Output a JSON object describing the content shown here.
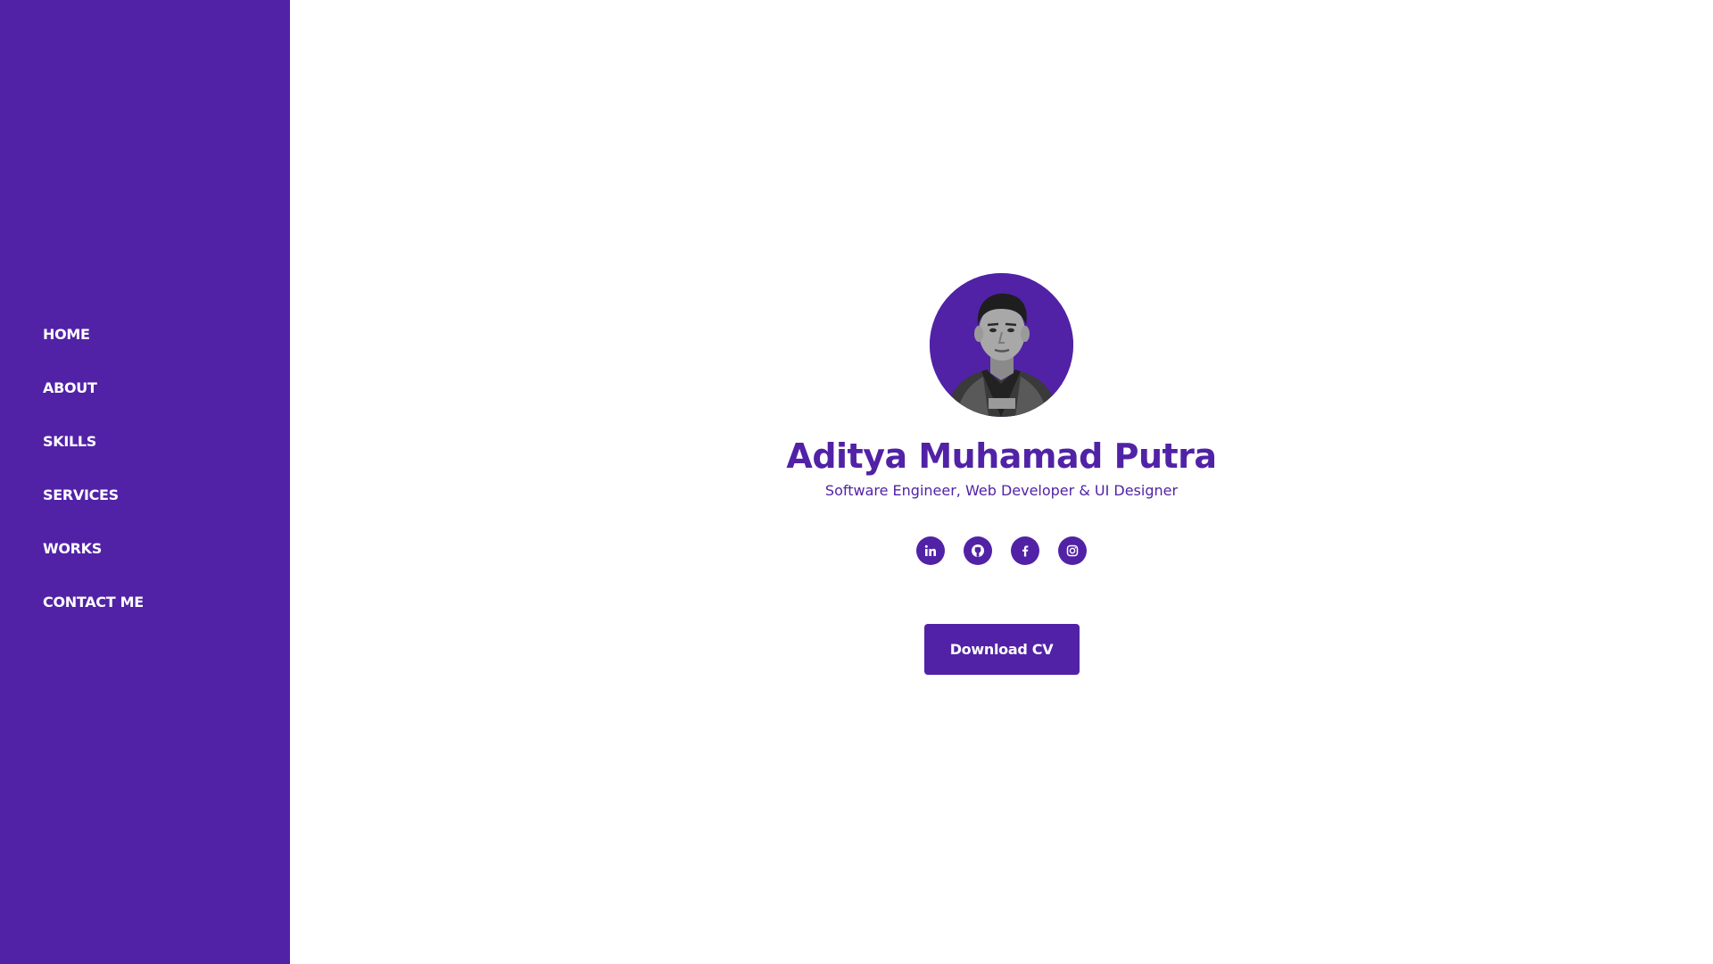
{
  "colors": {
    "accent": "#5122a6",
    "background": "#ffffff",
    "text_on_accent": "#ffffff"
  },
  "sidebar": {
    "items": [
      {
        "label": "HOME"
      },
      {
        "label": "ABOUT"
      },
      {
        "label": "SKILLS"
      },
      {
        "label": "SERVICES"
      },
      {
        "label": "WORKS"
      },
      {
        "label": "CONTACT ME"
      }
    ]
  },
  "hero": {
    "avatar_icon": "profile-photo",
    "name": "Aditya Muhamad Putra",
    "subtitle": "Software Engineer, Web Developer & UI Designer",
    "socials": [
      {
        "icon": "linkedin-icon"
      },
      {
        "icon": "github-icon"
      },
      {
        "icon": "facebook-icon"
      },
      {
        "icon": "instagram-icon"
      }
    ],
    "cta_label": "Download CV"
  }
}
